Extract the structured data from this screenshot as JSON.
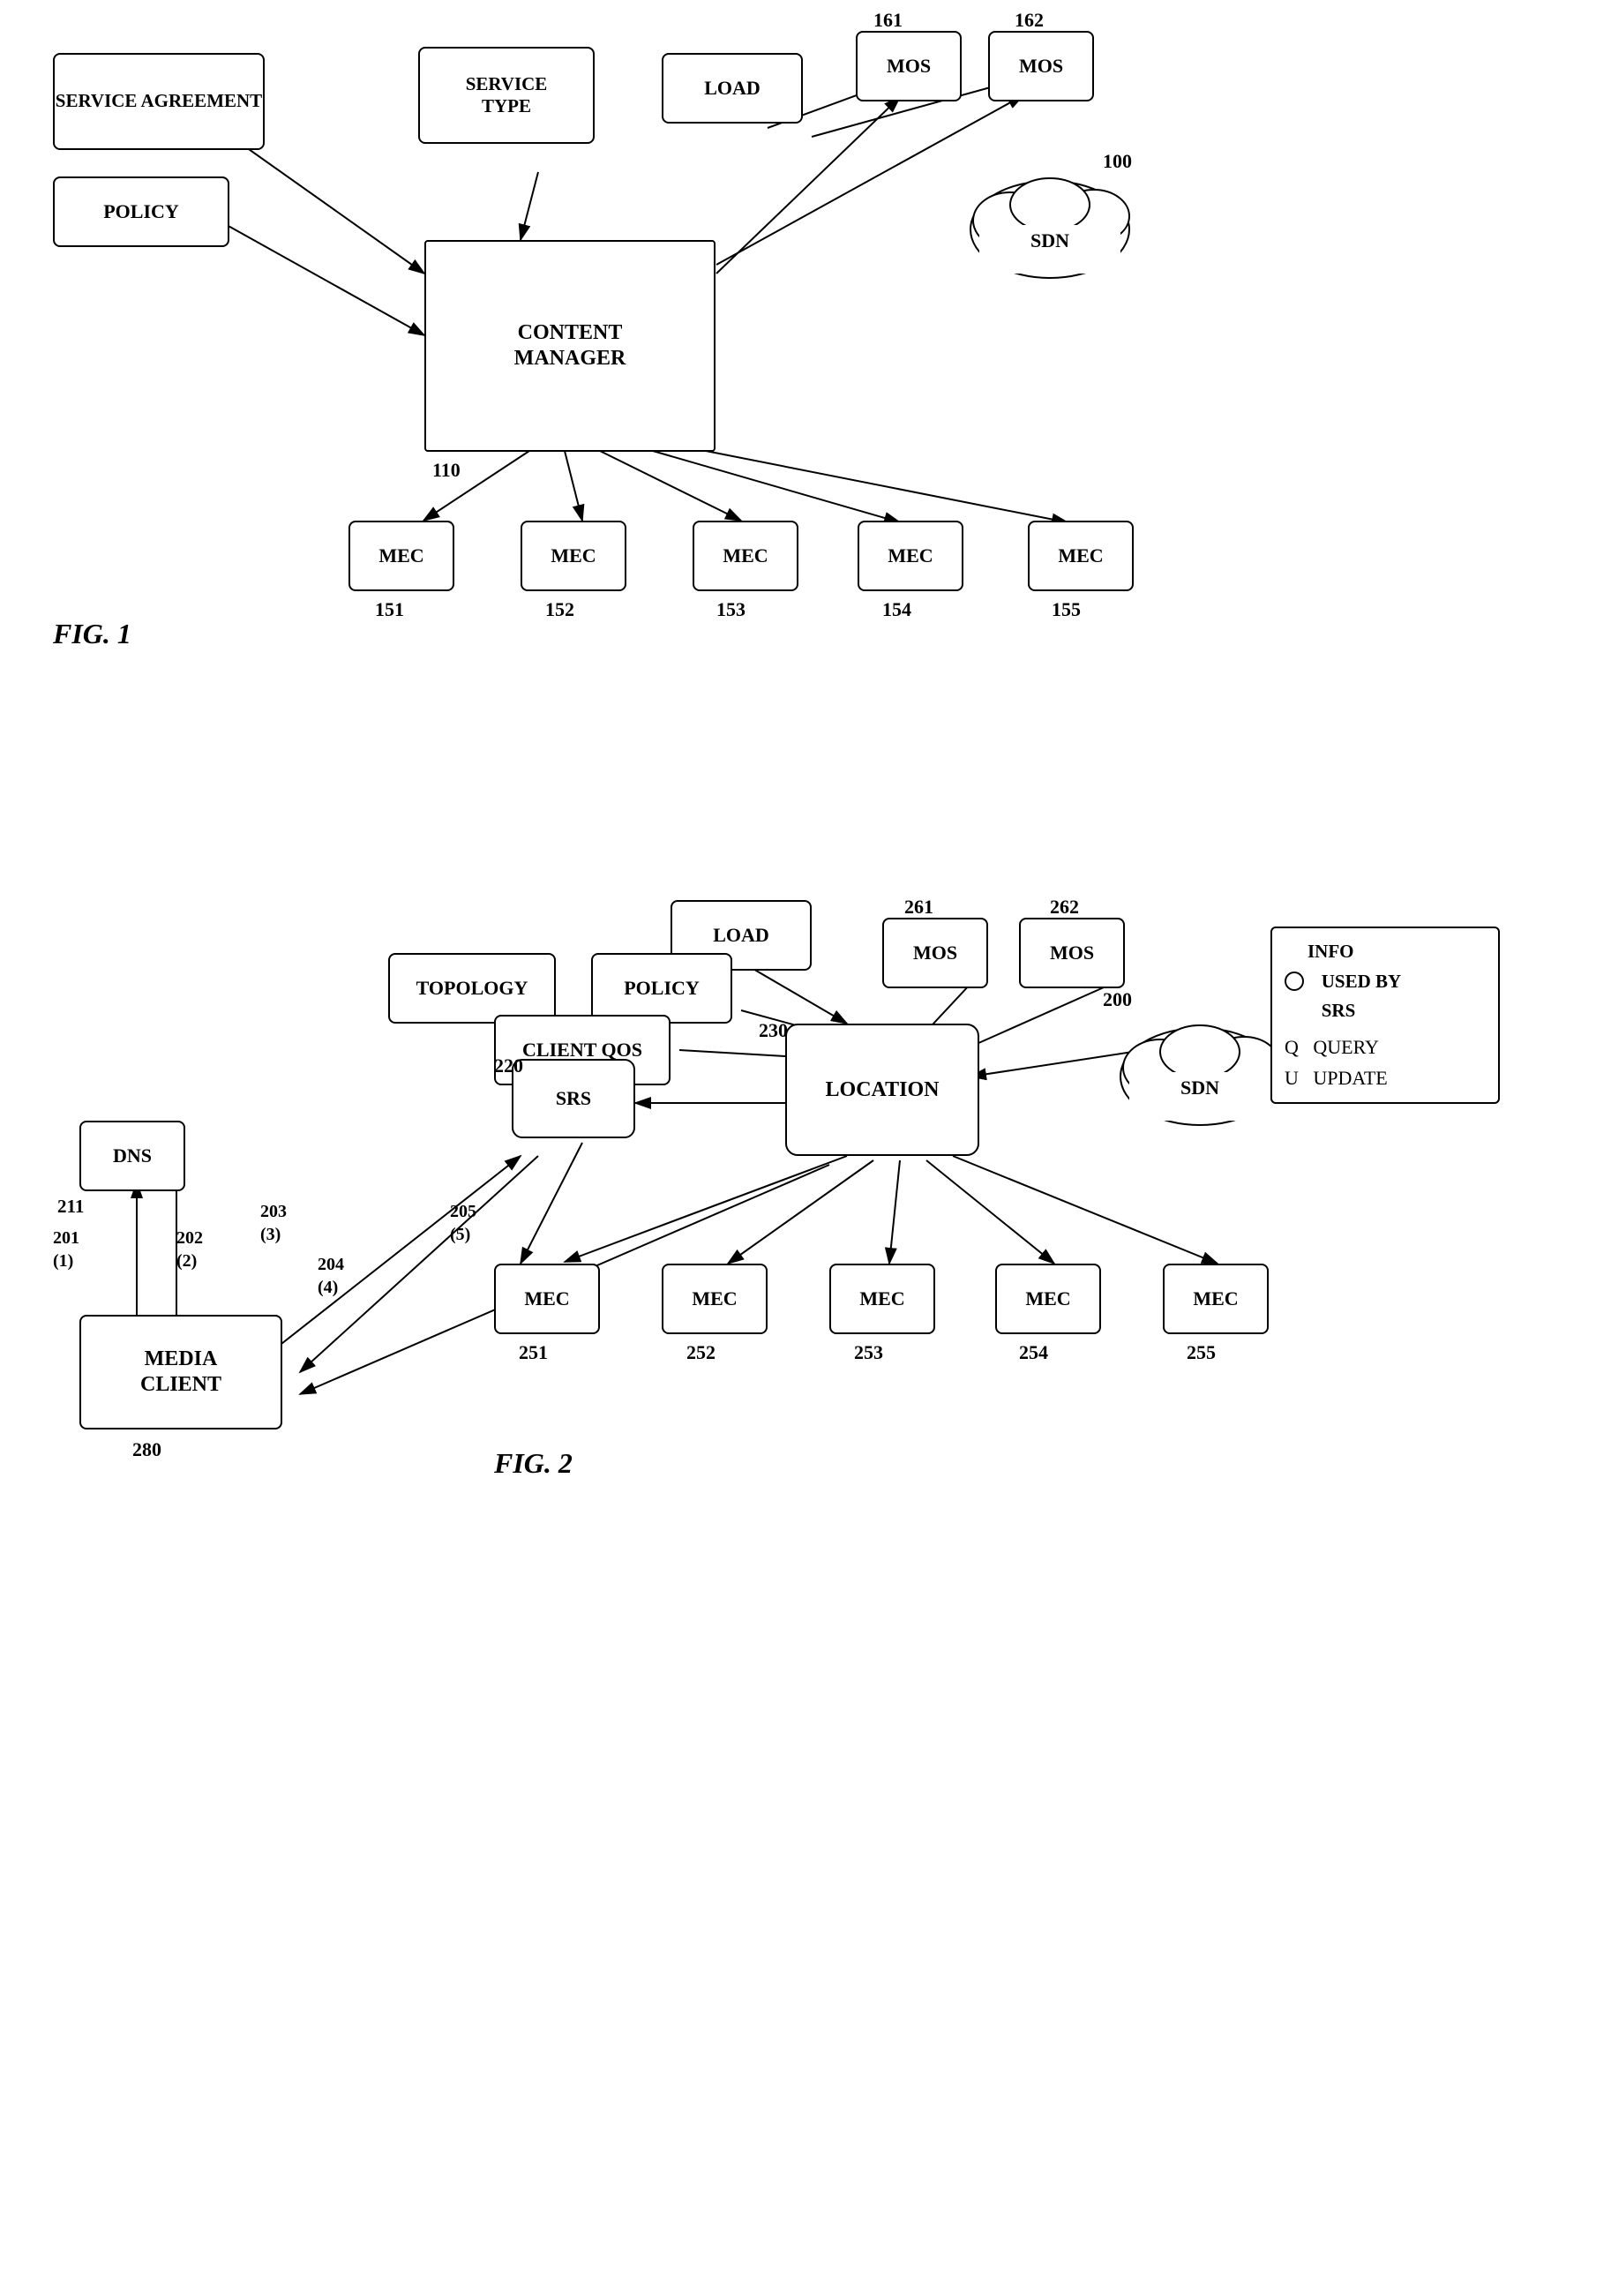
{
  "fig1": {
    "title": "FIG. 1",
    "nodes": {
      "service_agreement": "SERVICE\nAGREEMENT",
      "service_type": "SERVICE\nTYPE",
      "policy": "POLICY",
      "load": "LOAD",
      "content_manager": "CONTENT\nMANAGER",
      "sdn": "SDN",
      "mos1": "MOS",
      "mos2": "MOS",
      "mec1": "MEC",
      "mec2": "MEC",
      "mec3": "MEC",
      "mec4": "MEC",
      "mec5": "MEC"
    },
    "labels": {
      "cm_num": "110",
      "sdn_num": "100",
      "mos1_num": "161",
      "mos2_num": "162",
      "mec1_num": "151",
      "mec2_num": "152",
      "mec3_num": "153",
      "mec4_num": "154",
      "mec5_num": "155"
    }
  },
  "fig2": {
    "title": "FIG. 2",
    "nodes": {
      "load": "LOAD",
      "topology": "TOPOLOGY",
      "policy": "POLICY",
      "client_qos": "CLIENT QOS",
      "dns": "DNS",
      "srs": "SRS",
      "location": "LOCATION",
      "sdn": "SDN",
      "mos1": "MOS",
      "mos2": "MOS",
      "mec1": "MEC",
      "mec2": "MEC",
      "mec3": "MEC",
      "mec4": "MEC",
      "mec5": "MEC",
      "media_client": "MEDIA\nCLIENT"
    },
    "labels": {
      "dns_num": "211",
      "srs_num": "220",
      "location_num": "230",
      "sdn_num": "200",
      "mos1_num": "261",
      "mos2_num": "262",
      "mec1_num": "251",
      "mec2_num": "252",
      "mec3_num": "253",
      "mec4_num": "254",
      "mec5_num": "255",
      "mc_num": "280",
      "arrow1": "201\n(1)",
      "arrow2": "202\n(2)",
      "arrow3": "203\n(3)",
      "arrow4": "204\n(4)",
      "arrow5": "205\n(5)"
    },
    "legend": {
      "line1": "INFO",
      "line2": "USED BY",
      "line3": "SRS",
      "line4": "Q  QUERY",
      "line5": "U  UPDATE"
    }
  }
}
